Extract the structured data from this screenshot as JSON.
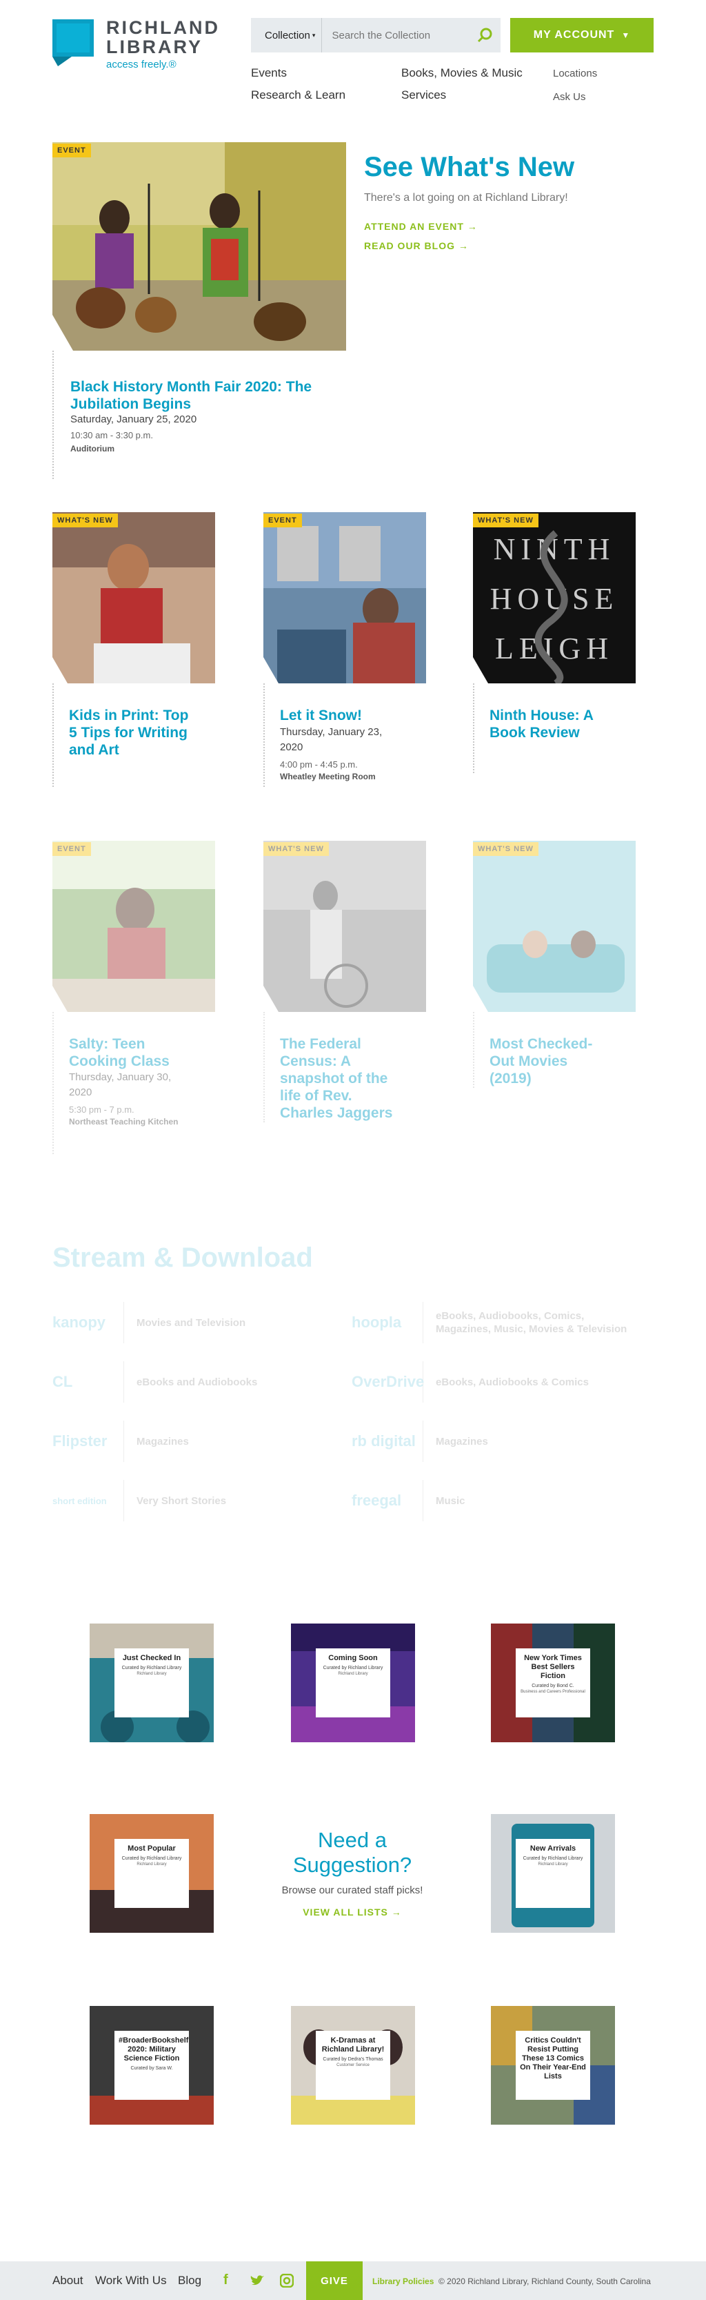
{
  "header": {
    "logo_name_line1": "RICHLAND",
    "logo_name_line2": "LIBRARY",
    "logo_tagline": "access freely.®",
    "search_scope": "Collection",
    "search_placeholder": "Search the Collection",
    "account_label": "MY ACCOUNT",
    "nav": {
      "events": "Events",
      "books": "Books, Movies & Music",
      "locations": "Locations",
      "research": "Research & Learn",
      "services": "Services",
      "ask": "Ask Us"
    }
  },
  "hero": {
    "tag": "EVENT",
    "title": "Black History Month Fair 2020: The Jubilation Begins",
    "date": "Saturday, January 25, 2020",
    "time": "10:30 am - 3:30 p.m.",
    "location": "Auditorium"
  },
  "whats_new": {
    "title": "See What's New",
    "subtitle": "There's a lot going on at Richland Library!",
    "attend_link": "ATTEND AN EVENT →",
    "blog_link": "READ OUR BLOG →"
  },
  "cards_row1": [
    {
      "tag": "WHAT'S NEW",
      "title": "Kids in Print: Top 5 Tips for Writing and Art"
    },
    {
      "tag": "EVENT",
      "title": "Let it Snow!",
      "date": "Thursday, January 23, 2020",
      "time": "4:00 pm - 4:45 p.m.",
      "location": "Wheatley Meeting Room"
    },
    {
      "tag": "WHAT'S NEW",
      "title": "Ninth House: A Book Review",
      "cover_text": [
        "NINTH",
        "HOUSE",
        "LEIGH"
      ]
    }
  ],
  "cards_row2": [
    {
      "tag": "EVENT",
      "title": "Salty: Teen Cooking Class",
      "date": "Thursday, January 30, 2020",
      "time": "5:30 pm - 7 p.m.",
      "location": "Northeast Teaching Kitchen"
    },
    {
      "tag": "WHAT'S NEW",
      "title": "The Federal Census: A snapshot of the life of Rev. Charles Jaggers"
    },
    {
      "tag": "WHAT'S NEW",
      "title": "Most Checked-Out Movies (2019)"
    }
  ],
  "stream": {
    "title": "Stream & Download",
    "services": [
      {
        "logo": "kanopy",
        "desc": "Movies and Television"
      },
      {
        "logo": "hoopla",
        "desc": "eBooks, Audiobooks, Comics, Magazines, Music, Movies & Television"
      },
      {
        "logo": "CL",
        "desc": "eBooks and Audiobooks"
      },
      {
        "logo": "OverDrive",
        "desc": "eBooks, Audiobooks & Comics"
      },
      {
        "logo": "Flipster",
        "desc": "Magazines"
      },
      {
        "logo": "rb digital",
        "desc": "Magazines"
      },
      {
        "logo": "short edition",
        "desc": "Very Short Stories"
      },
      {
        "logo": "freegal",
        "desc": "Music"
      }
    ]
  },
  "lists": [
    {
      "title": "Just Checked In",
      "sub": "Curated by Richland Library",
      "by": "Richland Library",
      "color": "#2a7f8f"
    },
    {
      "title": "Coming Soon",
      "sub": "Curated by Richland Library",
      "by": "Richland Library",
      "color": "#4b2f8a"
    },
    {
      "title": "New York Times Best Sellers Fiction",
      "sub": "Curated by Bond C.",
      "by": "Business and Careers Professional",
      "color": "#2c4660"
    },
    {
      "title": "Most Popular",
      "sub": "Curated by Richland Library",
      "by": "Richland Library",
      "color": "#d47d4a"
    },
    {
      "title": "New Arrivals",
      "sub": "Curated by Richland Library",
      "by": "Richland Library",
      "color": "#cfd4d8"
    },
    {
      "title": "#BroaderBookshelf 2020: Military Science Fiction",
      "sub": "Curated by Sara W.",
      "by": "",
      "color": "#3a3a3a"
    },
    {
      "title": "K-Dramas at Richland Library!",
      "sub": "Curated by Dedra's Thomas",
      "by": "Customer Service",
      "color": "#d8d2c8"
    },
    {
      "title": "Critics Couldn't Resist Putting These 13 Comics On Their Year-End Lists",
      "sub": "",
      "by": "",
      "color": "#7a8a6a"
    }
  ],
  "suggestion": {
    "title": "Need a Suggestion?",
    "subtitle": "Browse our curated staff picks!",
    "link": "VIEW ALL LISTS →"
  },
  "footer": {
    "about": "About",
    "work": "Work With Us",
    "blog": "Blog",
    "give": "GIVE",
    "policies": "Library Policies",
    "copyright": "© 2020 Richland Library, Richland County, South Carolina"
  }
}
